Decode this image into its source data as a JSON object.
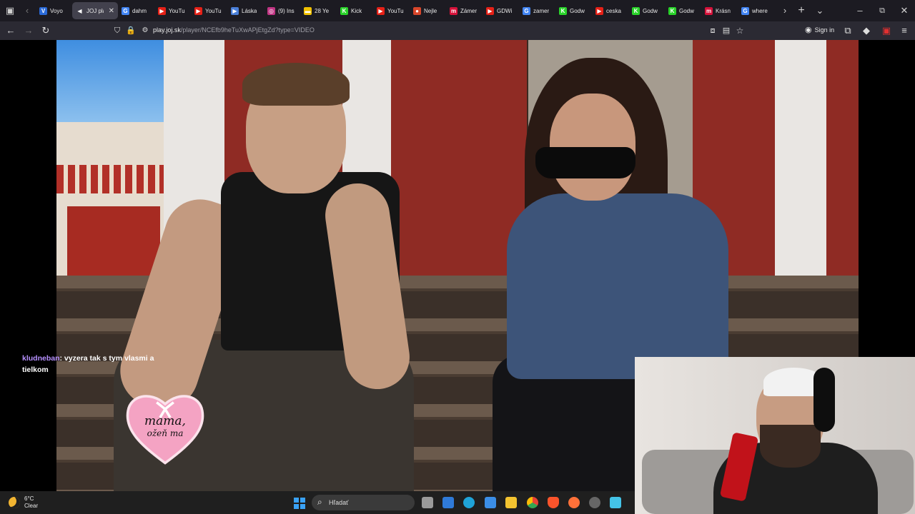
{
  "browser": {
    "tabs": [
      {
        "label": "Voyo",
        "favicon": "V",
        "color": "#2a6ad8"
      },
      {
        "label": "JOJ pla",
        "favicon": "◀",
        "color": "#42414d",
        "active": true
      },
      {
        "label": "dahm",
        "favicon": "G",
        "color": "#4285f4"
      },
      {
        "label": "YouTu",
        "favicon": "▶",
        "color": "#e62117"
      },
      {
        "label": "YouTu",
        "favicon": "▶",
        "color": "#e62117"
      },
      {
        "label": "Láska",
        "favicon": "▶",
        "color": "#4a7fd8"
      },
      {
        "label": "(9) Ins",
        "favicon": "◎",
        "color": "#c13584"
      },
      {
        "label": "28 Ye",
        "favicon": "▬",
        "color": "#f2c200"
      },
      {
        "label": "Kick",
        "favicon": "K",
        "color": "#2ad32a"
      },
      {
        "label": "YouTu",
        "favicon": "▶",
        "color": "#e62117"
      },
      {
        "label": "Nejle",
        "favicon": "●",
        "color": "#d8462a"
      },
      {
        "label": "Zámer",
        "favicon": "m",
        "color": "#d6123a"
      },
      {
        "label": "GDWi",
        "favicon": "▶",
        "color": "#e62117"
      },
      {
        "label": "zamer",
        "favicon": "G",
        "color": "#4285f4"
      },
      {
        "label": "Godw",
        "favicon": "K",
        "color": "#2ad32a"
      },
      {
        "label": "ceska",
        "favicon": "▶",
        "color": "#e62117"
      },
      {
        "label": "Godw",
        "favicon": "K",
        "color": "#2ad32a"
      },
      {
        "label": "Godw",
        "favicon": "K",
        "color": "#2ad32a"
      },
      {
        "label": "Krásn",
        "favicon": "m",
        "color": "#d6123a"
      },
      {
        "label": "where",
        "favicon": "G",
        "color": "#4285f4"
      }
    ],
    "close_tab_glyph": "✕",
    "url_host": "play.joj.sk",
    "url_path": "/player/NCEfb9heTuXwAPjEtgZd?type=VIDEO",
    "signin_label": "Sign in"
  },
  "video": {
    "chat_user": "kludneban",
    "chat_message": ": vyzera tak s tym vlasmi a tielkom",
    "heart_line1": "mama,",
    "heart_line2": "ožeň ma"
  },
  "taskbar": {
    "temperature": "6°C",
    "condition": "Clear",
    "search_placeholder": "Hľadať"
  }
}
